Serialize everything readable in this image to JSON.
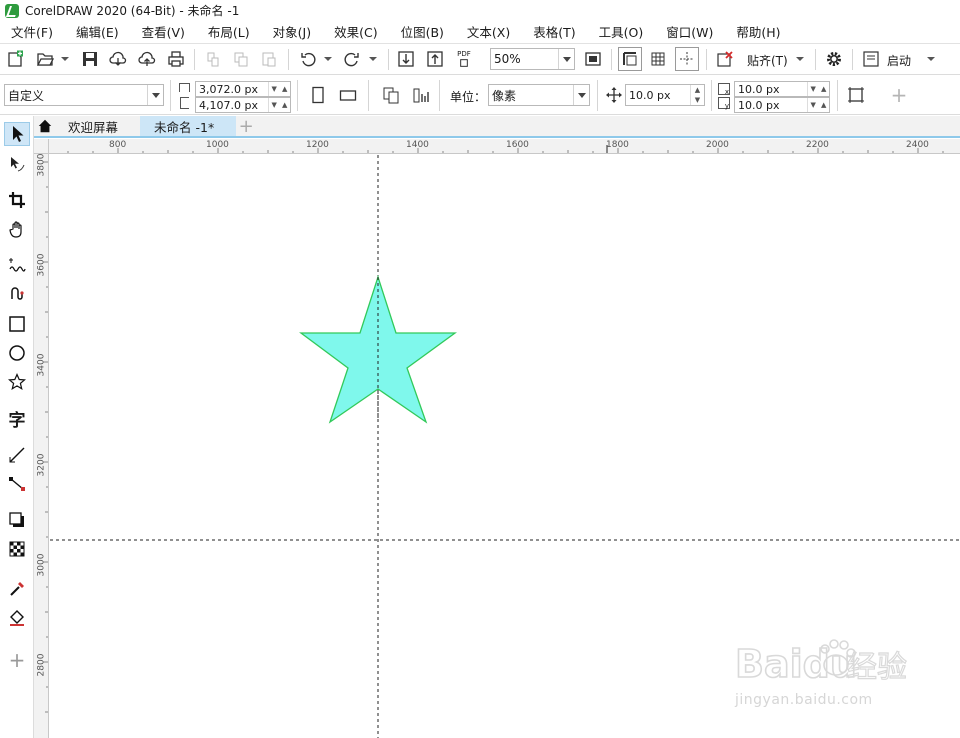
{
  "window": {
    "title": "CorelDRAW 2020 (64-Bit) - 未命名 -1"
  },
  "menu": [
    "文件(F)",
    "编辑(E)",
    "查看(V)",
    "布局(L)",
    "对象(J)",
    "效果(C)",
    "位图(B)",
    "文本(X)",
    "表格(T)",
    "工具(O)",
    "窗口(W)",
    "帮助(H)"
  ],
  "toolbar": {
    "zoom": "50%",
    "snap_label": "贴齐(T)",
    "launch_label": "启动",
    "pdf_label": "PDF"
  },
  "property_bar": {
    "preset": "自定义",
    "width": "3,072.0 px",
    "height": "4,107.0 px",
    "units_label": "单位：",
    "units_value": "像素",
    "nudge": "10.0 px",
    "dup_x": "10.0 px",
    "dup_y": "10.0 px"
  },
  "tabs": {
    "welcome": "欢迎屏幕",
    "document": "未命名 -1*"
  },
  "rulers": {
    "horizontal": [
      "800",
      "1000",
      "1200",
      "1400",
      "1600",
      "1800",
      "2000",
      "2200",
      "2400"
    ],
    "vertical": [
      "3800",
      "3600",
      "3400",
      "3200",
      "3000",
      "2800"
    ]
  },
  "toolbox_tools": [
    "pick-tool",
    "shape-tool",
    "crop-tool",
    "pan-tool",
    "freehand-tool",
    "artistic-media-tool",
    "rectangle-tool",
    "ellipse-tool",
    "polygon-tool",
    "text-tool",
    "parallel-dimension-tool",
    "connector-tool",
    "drop-shadow-tool",
    "transparency-tool",
    "eyedropper-tool",
    "interactive-fill-tool",
    "add-tool"
  ],
  "shape": {
    "type": "star",
    "fill": "#7ff8ec",
    "outline": "#32c95a"
  },
  "watermark": {
    "brand": "Baidu",
    "suffix": "经验",
    "url": "jingyan.baidu.com"
  }
}
